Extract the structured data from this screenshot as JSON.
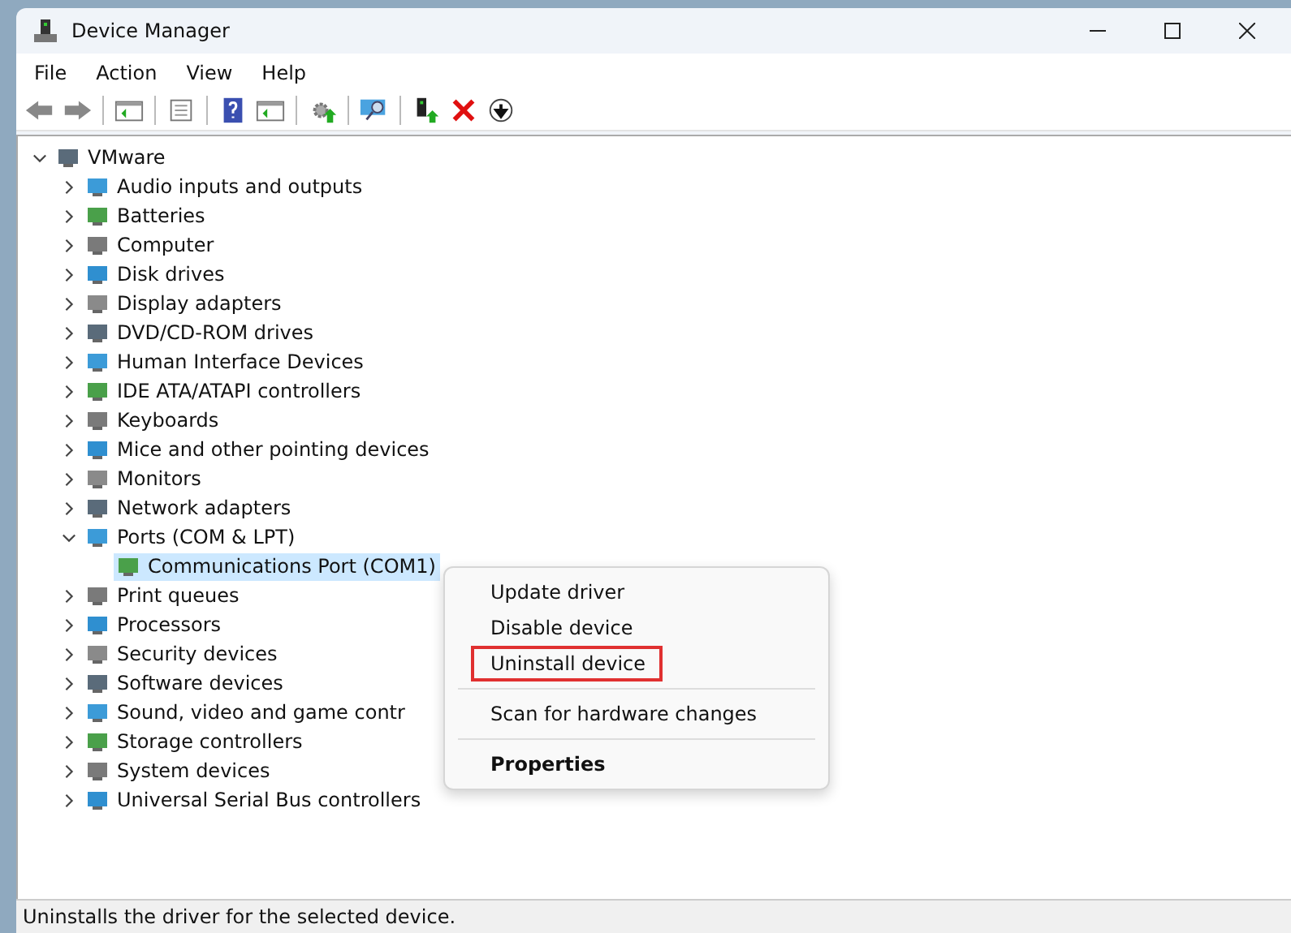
{
  "window": {
    "title": "Device Manager"
  },
  "menu_bar": [
    "File",
    "Action",
    "View",
    "Help"
  ],
  "toolbar": [
    {
      "kind": "back",
      "disabled": false
    },
    {
      "kind": "forward",
      "disabled": false
    },
    {
      "kind": "sep"
    },
    {
      "kind": "pane"
    },
    {
      "kind": "sep"
    },
    {
      "kind": "list"
    },
    {
      "kind": "sep"
    },
    {
      "kind": "help"
    },
    {
      "kind": "pane2"
    },
    {
      "kind": "sep"
    },
    {
      "kind": "gear"
    },
    {
      "kind": "sep"
    },
    {
      "kind": "scan"
    },
    {
      "kind": "sep"
    },
    {
      "kind": "update"
    },
    {
      "kind": "remove"
    },
    {
      "kind": "download"
    }
  ],
  "tree": [
    {
      "label": "VMware",
      "expanded": true,
      "selected": false,
      "children": [
        {
          "label": "Audio inputs and outputs",
          "expanded": false,
          "selected": false
        },
        {
          "label": "Batteries",
          "expanded": false,
          "selected": false
        },
        {
          "label": "Computer",
          "expanded": false,
          "selected": false
        },
        {
          "label": "Disk drives",
          "expanded": false,
          "selected": false
        },
        {
          "label": "Display adapters",
          "expanded": false,
          "selected": false
        },
        {
          "label": "DVD/CD-ROM drives",
          "expanded": false,
          "selected": false
        },
        {
          "label": "Human Interface Devices",
          "expanded": false,
          "selected": false
        },
        {
          "label": "IDE ATA/ATAPI controllers",
          "expanded": false,
          "selected": false
        },
        {
          "label": "Keyboards",
          "expanded": false,
          "selected": false
        },
        {
          "label": "Mice and other pointing devices",
          "expanded": false,
          "selected": false
        },
        {
          "label": "Monitors",
          "expanded": false,
          "selected": false
        },
        {
          "label": "Network adapters",
          "expanded": false,
          "selected": false
        },
        {
          "label": "Ports (COM & LPT)",
          "expanded": true,
          "selected": false,
          "children": [
            {
              "label": "Communications Port (COM1)",
              "selected": true
            }
          ]
        },
        {
          "label": "Print queues",
          "expanded": false,
          "selected": false
        },
        {
          "label": "Processors",
          "expanded": false,
          "selected": false
        },
        {
          "label": "Security devices",
          "expanded": false,
          "selected": false
        },
        {
          "label": "Software devices",
          "expanded": false,
          "selected": false
        },
        {
          "label": "Sound, video and game contr",
          "expanded": false,
          "selected": false
        },
        {
          "label": "Storage controllers",
          "expanded": false,
          "selected": false
        },
        {
          "label": "System devices",
          "expanded": false,
          "selected": false
        },
        {
          "label": "Universal Serial Bus controllers",
          "expanded": false,
          "selected": false
        }
      ]
    }
  ],
  "context_menu": [
    {
      "kind": "item",
      "label": "Update driver",
      "bold": false,
      "outlined": false
    },
    {
      "kind": "item",
      "label": "Disable device",
      "bold": false,
      "outlined": false
    },
    {
      "kind": "item",
      "label": "Uninstall device",
      "bold": false,
      "outlined": true
    },
    {
      "kind": "separator"
    },
    {
      "kind": "item",
      "label": "Scan for hardware changes",
      "bold": false,
      "outlined": false
    },
    {
      "kind": "separator"
    },
    {
      "kind": "item",
      "label": "Properties",
      "bold": true,
      "outlined": false
    }
  ],
  "status_bar": "Uninstalls the driver for the selected device."
}
